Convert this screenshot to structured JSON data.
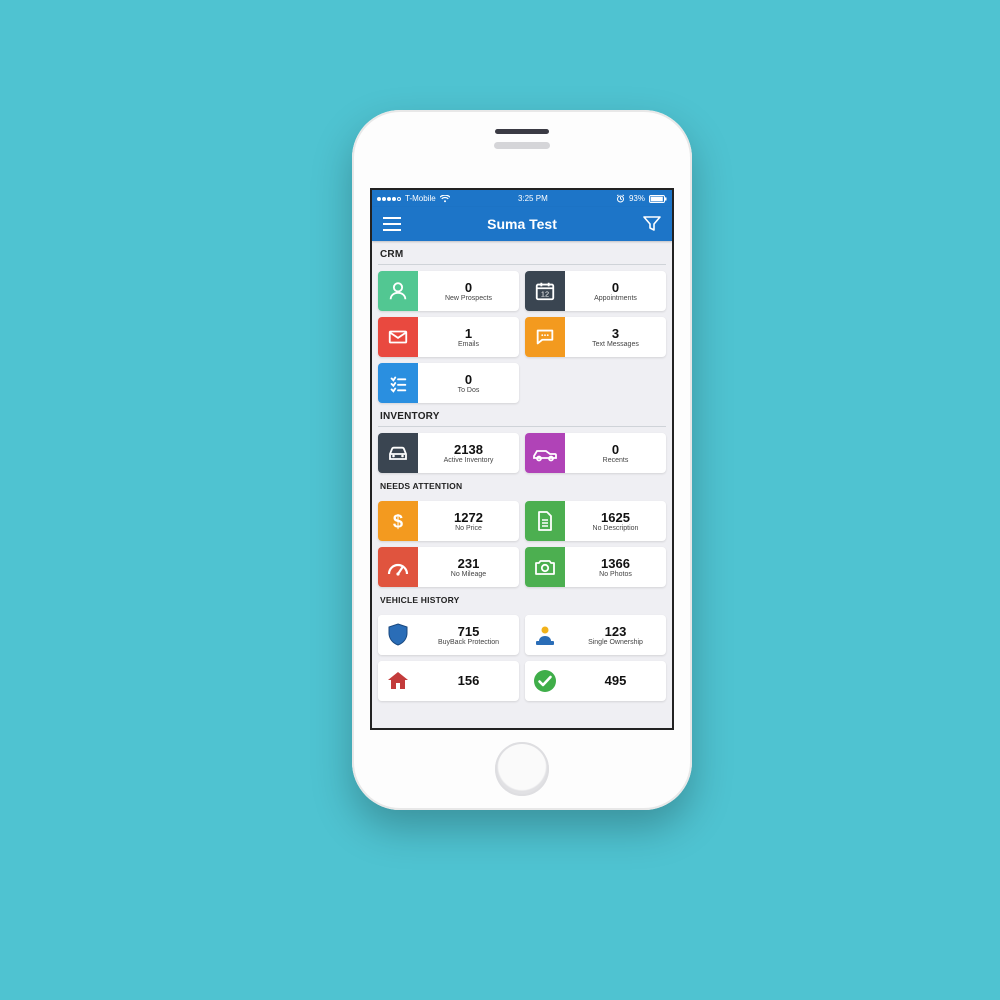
{
  "status": {
    "carrier": "T-Mobile",
    "time": "3:25 PM",
    "battery": "93%"
  },
  "header": {
    "title": "Suma Test"
  },
  "sections": {
    "crm": {
      "title": "CRM",
      "tiles": [
        {
          "icon": "person",
          "color": "#52c792",
          "value": "0",
          "label": "New Prospects"
        },
        {
          "icon": "calendar",
          "color": "#3a4551",
          "value": "0",
          "label": "Appointments"
        },
        {
          "icon": "mail",
          "color": "#e9493f",
          "value": "1",
          "label": "Emails"
        },
        {
          "icon": "chat",
          "color": "#f39a1f",
          "value": "3",
          "label": "Text Messages"
        },
        {
          "icon": "todo",
          "color": "#2a8fe0",
          "value": "0",
          "label": "To Dos"
        }
      ]
    },
    "inventory": {
      "title": "INVENTORY",
      "tiles": [
        {
          "icon": "car",
          "color": "#3a4551",
          "value": "2138",
          "label": "Active Inventory"
        },
        {
          "icon": "carside",
          "color": "#b043b7",
          "value": "0",
          "label": "Recents"
        }
      ]
    },
    "needs": {
      "title": "NEEDS ATTENTION",
      "tiles": [
        {
          "icon": "dollar",
          "color": "#f39a1f",
          "value": "1272",
          "label": "No Price"
        },
        {
          "icon": "doc",
          "color": "#4caf50",
          "value": "1625",
          "label": "No Description"
        },
        {
          "icon": "gauge",
          "color": "#e0543e",
          "value": "231",
          "label": "No Mileage"
        },
        {
          "icon": "camera",
          "color": "#4caf50",
          "value": "1366",
          "label": "No Photos"
        }
      ]
    },
    "history": {
      "title": "VEHICLE HISTORY",
      "tiles": [
        {
          "icon": "shield",
          "plain": true,
          "value": "715",
          "label": "BuyBack Protection"
        },
        {
          "icon": "owner",
          "plain": true,
          "value": "123",
          "label": "Single Ownership"
        },
        {
          "icon": "house",
          "plain": true,
          "value": "156",
          "label": ""
        },
        {
          "icon": "check",
          "plain": true,
          "value": "495",
          "label": ""
        }
      ]
    }
  }
}
